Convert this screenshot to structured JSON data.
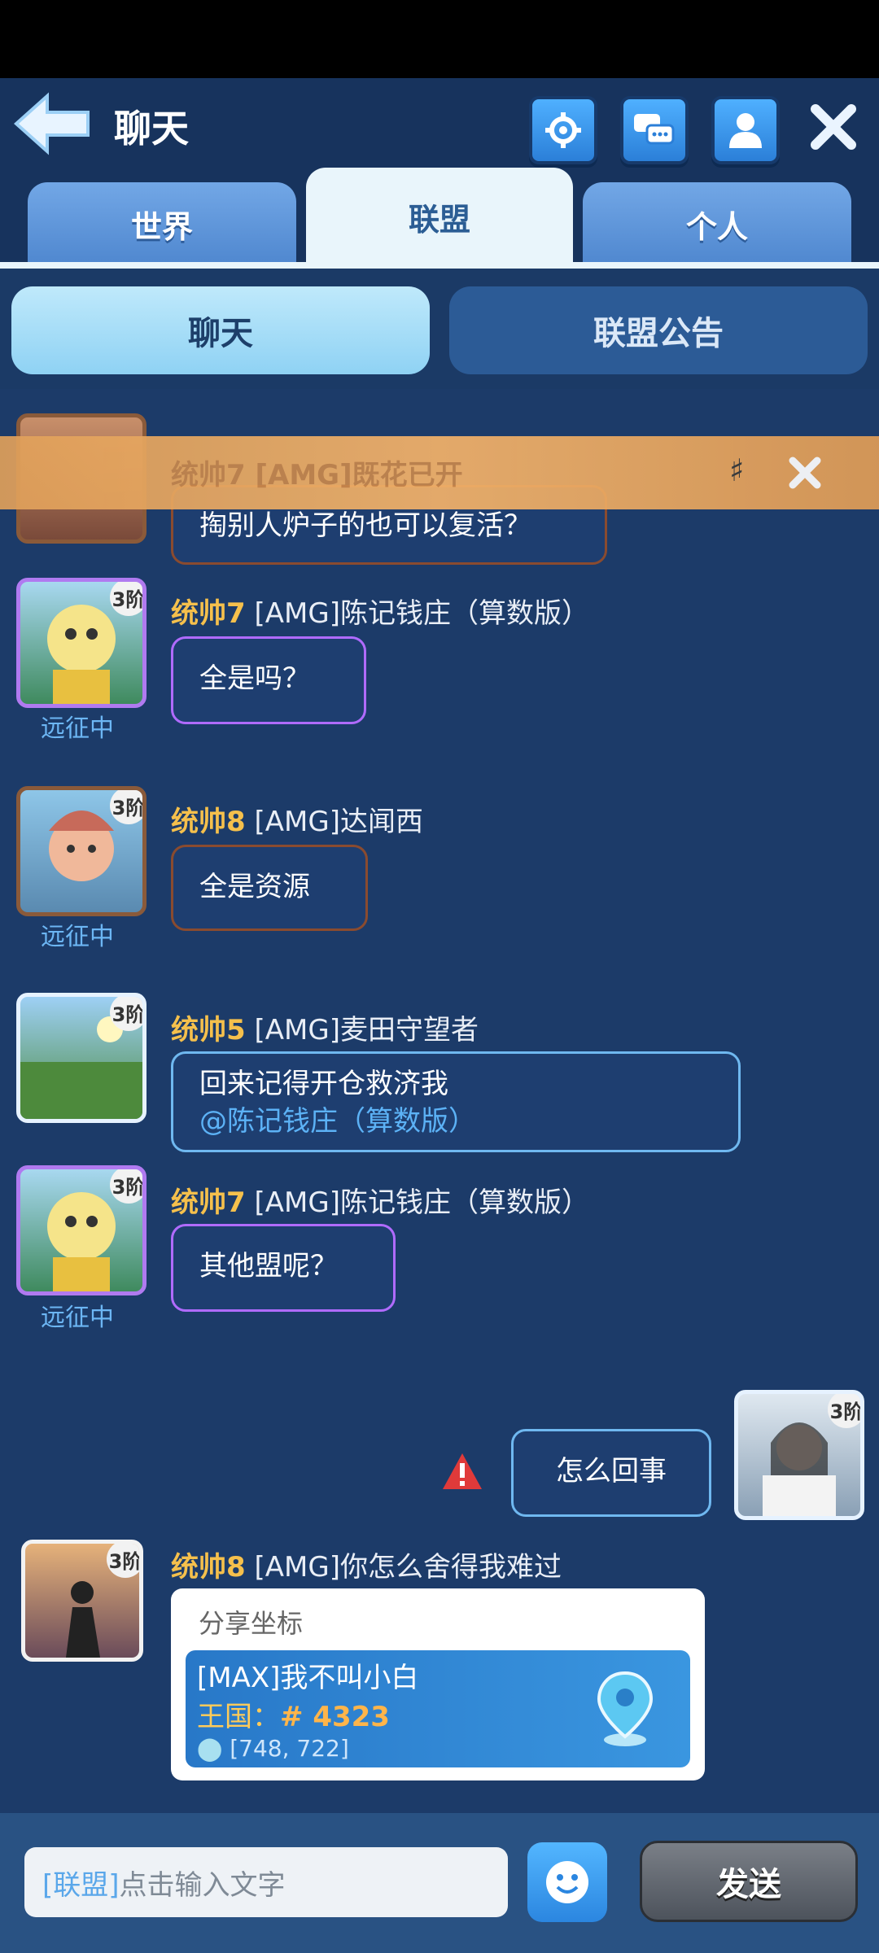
{
  "header": {
    "title": "聊天",
    "tabs": [
      {
        "label": "世界",
        "active": false
      },
      {
        "label": "联盟",
        "active": true
      },
      {
        "label": "个人",
        "active": false
      }
    ]
  },
  "subtabs": {
    "chat": "聊天",
    "notice": "联盟公告"
  },
  "banner": {
    "text": "统帅7 [AMG]既花已开"
  },
  "messages": [
    {
      "rank_title": "统帅7",
      "alliance": "[AMG]",
      "name": "陈记钱庄（算数版）",
      "text": "全是吗？",
      "avatar_rank": "3阶",
      "status": "远征中"
    },
    {
      "rank_title": "统帅8",
      "alliance": "[AMG]",
      "name": "达闻西",
      "text": "全是资源",
      "avatar_rank": "3阶",
      "status": "远征中"
    },
    {
      "rank_title": "统帅5",
      "alliance": "[AMG]",
      "name": "麦田守望者",
      "text": "回来记得开仓救济我",
      "mention": "@陈记钱庄（算数版）",
      "avatar_rank": "3阶"
    },
    {
      "rank_title": "统帅7",
      "alliance": "[AMG]",
      "name": "陈记钱庄（算数版）",
      "text": "其他盟呢？",
      "avatar_rank": "3阶",
      "status": "远征中"
    },
    {
      "text": "怎么回事",
      "avatar_rank": "3阶"
    },
    {
      "rank_title": "统帅8",
      "alliance": "[AMG]",
      "name": "你怎么舍得我难过",
      "avatar_rank": "3阶"
    }
  ],
  "partial_message": {
    "text": "掏别人炉子的也可以复活？"
  },
  "share": {
    "title": "分享坐标",
    "player": "[MAX]我不叫小白",
    "kingdom_label": "王国：",
    "kingdom_value": "# 4323",
    "coords": "[748, 722]"
  },
  "input": {
    "tag": "[联盟]",
    "placeholder": "点击输入文字"
  },
  "send_label": "发送"
}
